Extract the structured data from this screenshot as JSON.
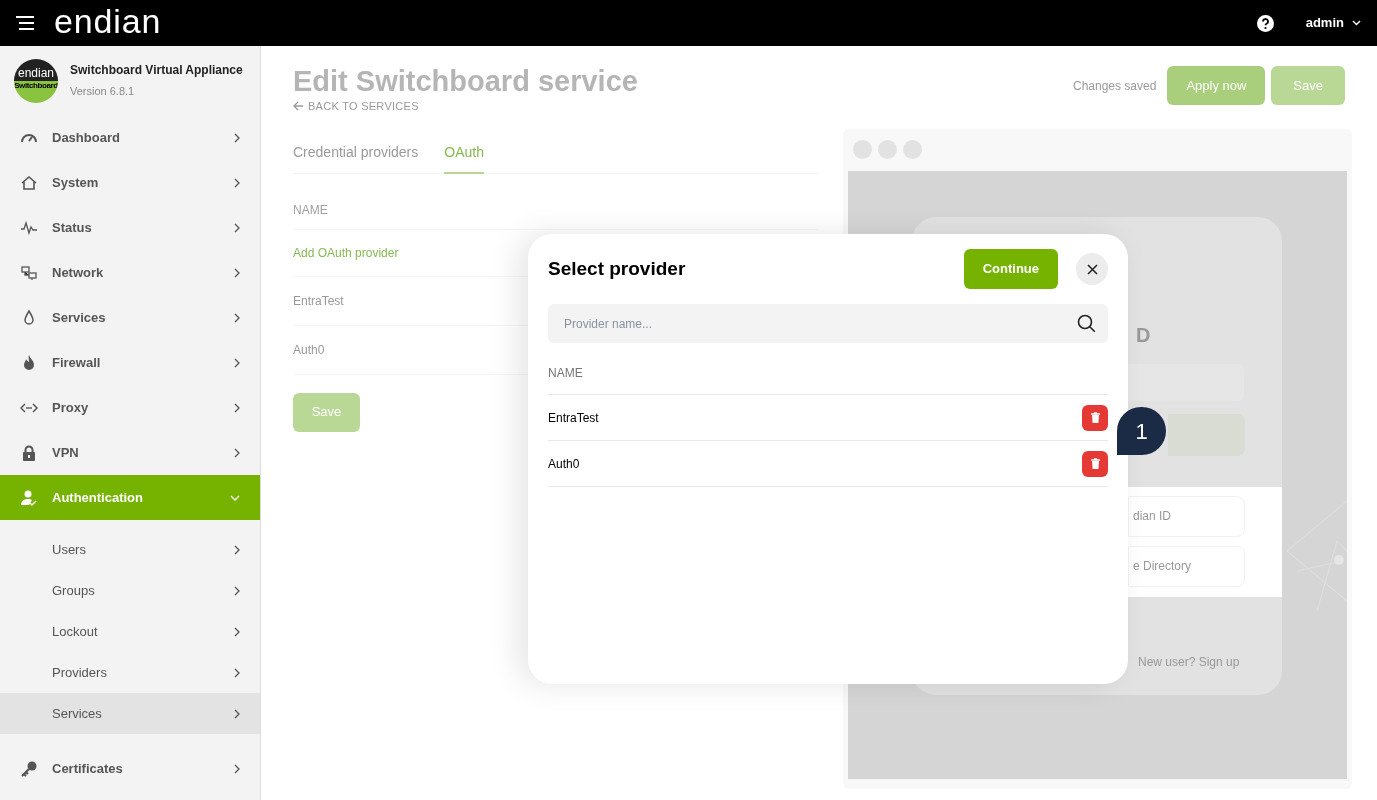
{
  "topbar": {
    "logo": "endian",
    "user": "admin"
  },
  "sidebar": {
    "product": {
      "name": "Switchboard Virtual Appliance",
      "version": "Version 6.8.1",
      "badge_top": "endian",
      "badge_bottom": "Switchboard"
    },
    "items": [
      {
        "label": "Dashboard",
        "expanded": false,
        "selected": false
      },
      {
        "label": "System",
        "expanded": false,
        "selected": false
      },
      {
        "label": "Status",
        "expanded": false,
        "selected": false
      },
      {
        "label": "Network",
        "expanded": false,
        "selected": false
      },
      {
        "label": "Services",
        "expanded": false,
        "selected": false
      },
      {
        "label": "Firewall",
        "expanded": false,
        "selected": false
      },
      {
        "label": "Proxy",
        "expanded": false,
        "selected": false
      },
      {
        "label": "VPN",
        "expanded": false,
        "selected": false
      },
      {
        "label": "Authentication",
        "expanded": true,
        "selected": true,
        "children": [
          {
            "label": "Users",
            "selected": false
          },
          {
            "label": "Groups",
            "selected": false
          },
          {
            "label": "Lockout",
            "selected": false
          },
          {
            "label": "Providers",
            "selected": false
          },
          {
            "label": "Services",
            "selected": true
          }
        ]
      },
      {
        "label": "Certificates",
        "expanded": false,
        "selected": false
      }
    ]
  },
  "page": {
    "title": "Edit Switchboard service",
    "back_link": "BACK TO SERVICES",
    "status": "Changes saved",
    "buttons": [
      "Apply now",
      "Save"
    ],
    "tabs": [
      {
        "label": "Credential providers",
        "selected": false
      },
      {
        "label": "OAuth",
        "selected": true
      }
    ],
    "table": {
      "column": "NAME",
      "add_link": "Add OAuth provider",
      "rows": [
        "EntraTest",
        "Auth0"
      ]
    },
    "save_button": "Save",
    "preview": {
      "heading": "D",
      "button_1": "dian ID",
      "button_2": "e Directory",
      "signup": "New user? Sign up"
    }
  },
  "modal": {
    "title": "Select provider",
    "continue": "Continue",
    "search": {
      "placeholder": "Provider name..."
    },
    "column": "NAME",
    "rows": [
      {
        "name": "EntraTest"
      },
      {
        "name": "Auth0"
      }
    ],
    "callout": "1"
  }
}
